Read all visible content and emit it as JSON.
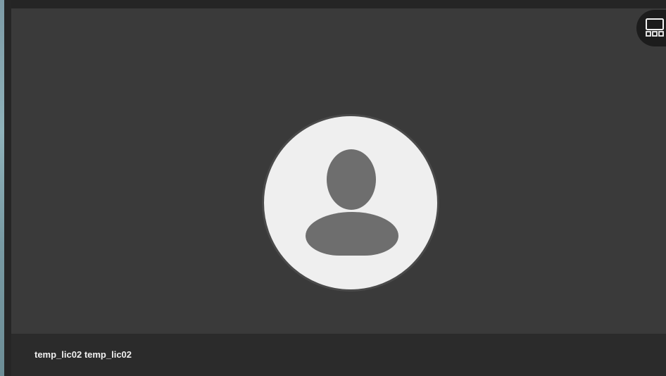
{
  "participant": {
    "display_name": "temp_lic02 temp_lic02"
  },
  "icons": {
    "avatar": "person-placeholder-icon",
    "layout": "filmstrip-layout-icon"
  },
  "colors": {
    "tile_background": "#3a3a3a",
    "name_bar_background": "#2b2b2b",
    "avatar_background": "#efefef",
    "avatar_figure": "#6e6e6e",
    "text": "#f0f0f0"
  }
}
